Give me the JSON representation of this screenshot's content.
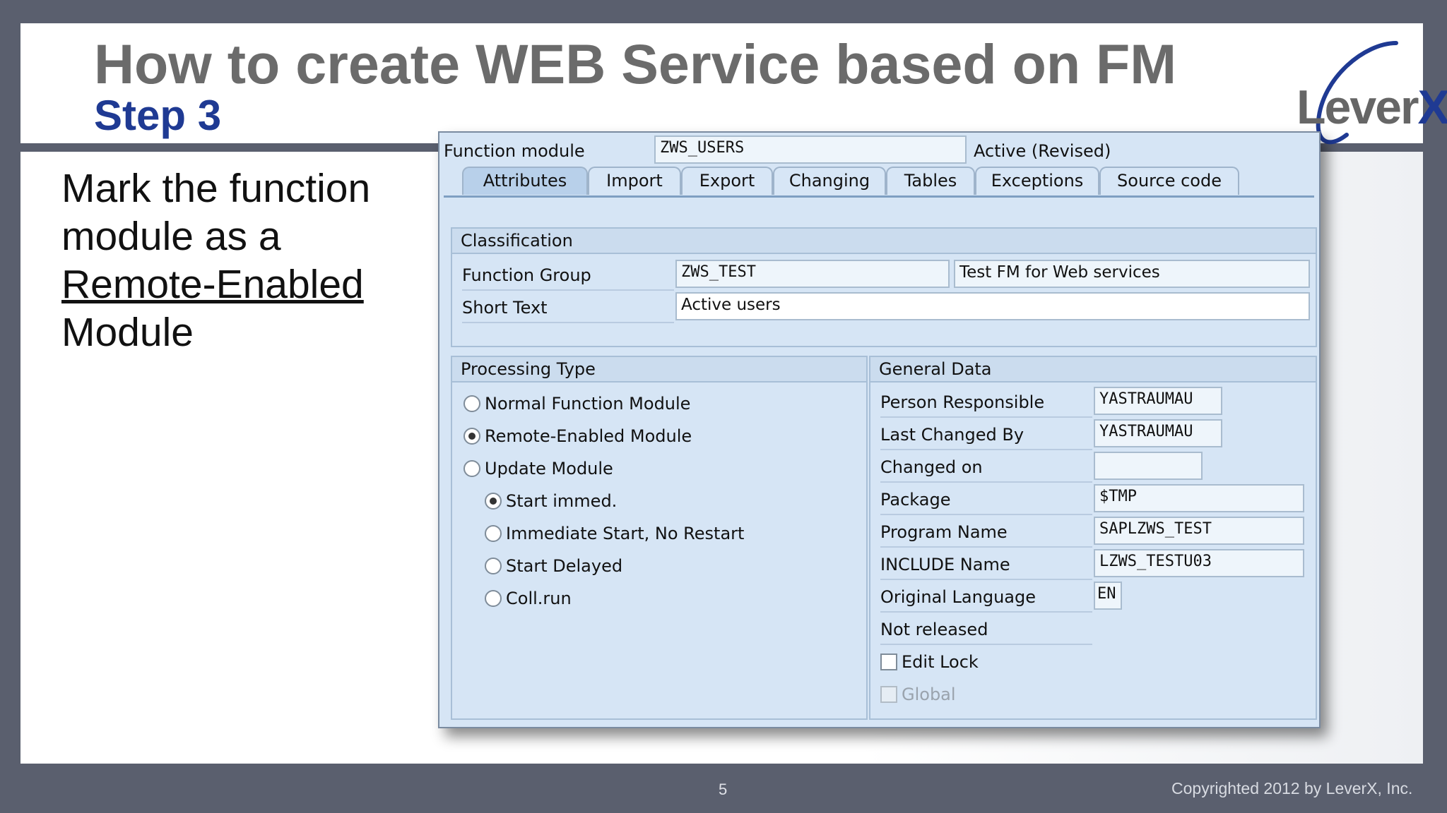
{
  "slide": {
    "title": "How to create WEB Service based on FM",
    "subtitle": "Step 3",
    "logo_text": "Lever",
    "logo_x": "X",
    "instruction": {
      "line1": "Mark the function",
      "line2": "module as a",
      "line3": "Remote-Enabled",
      "line4": "Module"
    },
    "page_number": "5",
    "copyright": "Copyrighted 2012 by LeverX, Inc."
  },
  "sap": {
    "function_module_label": "Function module",
    "function_module_value": "ZWS_USERS",
    "status": "Active (Revised)",
    "tabs": [
      "Attributes",
      "Import",
      "Export",
      "Changing",
      "Tables",
      "Exceptions",
      "Source code"
    ],
    "active_tab": "Attributes",
    "classification": {
      "title": "Classification",
      "function_group_label": "Function Group",
      "function_group_value": "ZWS_TEST",
      "function_group_desc": "Test FM for Web services",
      "short_text_label": "Short Text",
      "short_text_value": "Active users"
    },
    "processing_type": {
      "title": "Processing Type",
      "options": [
        {
          "label": "Normal Function Module",
          "selected": false
        },
        {
          "label": "Remote-Enabled Module",
          "selected": true
        },
        {
          "label": "Update Module",
          "selected": false
        }
      ],
      "update_options": [
        {
          "label": "Start immed.",
          "selected": true
        },
        {
          "label": "Immediate Start, No Restart",
          "selected": false
        },
        {
          "label": "Start Delayed",
          "selected": false
        },
        {
          "label": "Coll.run",
          "selected": false
        }
      ]
    },
    "general_data": {
      "title": "General Data",
      "person_responsible_label": "Person Responsible",
      "person_responsible_value": "YASTRAUMAU",
      "last_changed_by_label": "Last Changed By",
      "last_changed_by_value": "YASTRAUMAU",
      "changed_on_label": "Changed on",
      "changed_on_value": "",
      "package_label": "Package",
      "package_value": "$TMP",
      "program_name_label": "Program Name",
      "program_name_value": "SAPLZWS_TEST",
      "include_name_label": "INCLUDE Name",
      "include_name_value": "LZWS_TESTU03",
      "original_language_label": "Original Language",
      "original_language_value": "EN",
      "release_status": "Not released",
      "edit_lock_label": "Edit Lock",
      "edit_lock_checked": false,
      "global_label": "Global",
      "global_checked": false
    }
  }
}
